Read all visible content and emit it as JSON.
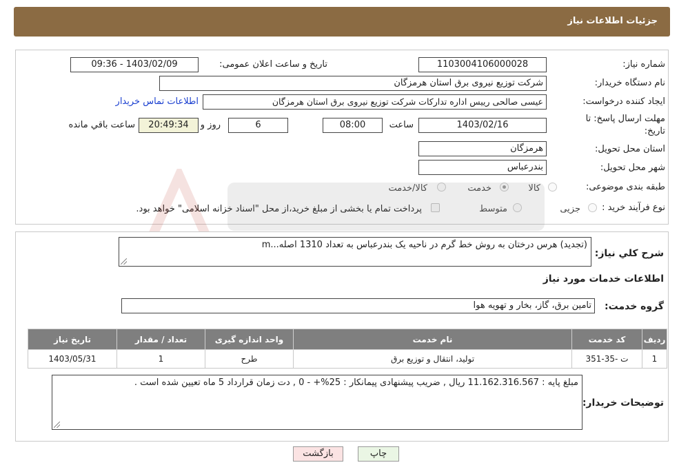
{
  "header": {
    "title": "جزئیات اطلاعات نیاز"
  },
  "form": {
    "need_number_label": "شماره نیاز:",
    "need_number": "1103004106000028",
    "announce_label": "تاریخ و ساعت اعلان عمومی:",
    "announce_value": "1403/02/09 - 09:36",
    "buyer_org_label": "نام دستگاه خریدار:",
    "buyer_org": "شرکت توزیع نیروی برق استان هرمزگان",
    "requester_label": "ایجاد کننده درخواست:",
    "requester": "عیسی صالحی  رییس اداره تدارکات شرکت توزیع نیروی برق استان هرمزگان",
    "contact_link": "اطلاعات تماس خریدار",
    "deadline_label": "مهلت ارسال پاسخ: تا",
    "deadline_label2": "تاریخ:",
    "deadline_date": "1403/02/16",
    "time_label": "ساعت",
    "deadline_time": "08:00",
    "days_value": "6",
    "days_label": "روز و",
    "remaining_time": "20:49:34",
    "remaining_label": "ساعت باقي مانده",
    "province_label": "استان محل تحویل:",
    "province": "هرمزگان",
    "city_label": "شهر محل تحویل:",
    "city": "بندرعباس",
    "category_label": "طبقه بندی موضوعی:",
    "category_options": [
      "کالا",
      "خدمت",
      "کالا/خدمت"
    ],
    "category_selected": "خدمت",
    "process_label": "نوع فرآیند خرید :",
    "process_options": [
      "جزیی",
      "متوسط"
    ],
    "payment_note": "پرداخت تمام یا بخشی از مبلغ خرید،از محل \"اسناد خزانه اسلامی\" خواهد بود."
  },
  "details": {
    "summary_label": "شرح کلي نياز:",
    "summary": "(تجدید) هرس درختان به روش خط گرم در ناحیه یک بندرعباس به تعداد 1310 اصله...m",
    "services_heading": "اطلاعات خدمات مورد نياز",
    "service_group_label": "گروه خدمت:",
    "service_group": "تامین برق، گاز، بخار و تهویه هوا",
    "table": {
      "headers": [
        "رديف",
        "کد خدمت",
        "نام خدمت",
        "واحد اندازه گیری",
        "تعداد / مقدار",
        "تاریخ نیاز"
      ],
      "rows": [
        [
          "1",
          "ت -35-351",
          "تولید، انتقال و توزیع برق",
          "طرح",
          "1",
          "1403/05/31"
        ]
      ]
    },
    "buyer_notes_label": "توضیحات خریدار:",
    "buyer_notes": "مبلغ پایه : 11.162.316.567 ریال , ضریب پیشنهادی پیمانکار : 25%+  - 0 , دت زمان قرارداد 5 ماه تعیین شده است ."
  },
  "buttons": {
    "print": "چاپ",
    "back": "بازگشت"
  },
  "colors": {
    "header": "#8b6b43",
    "table_header": "#7f7f7f",
    "link": "#1a3fd0"
  }
}
